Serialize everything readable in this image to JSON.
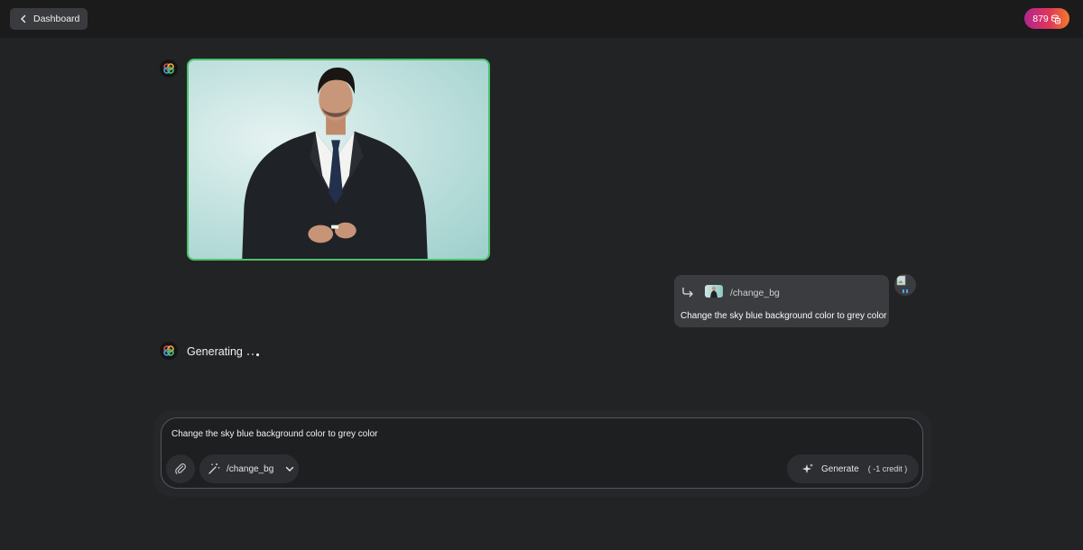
{
  "header": {
    "back_label": "Dashboard",
    "credits": "879"
  },
  "chat": {
    "generated_image_alt": "man in black suit against sky blue background",
    "user_message": {
      "command": "/change_bg",
      "text": "Change the sky blue background color to grey color"
    },
    "status": "Generating"
  },
  "composer": {
    "input_value": "Change the sky blue background color to grey color",
    "selected_command": "/change_bg",
    "generate_label": "Generate",
    "generate_cost": "( -1 credit )"
  },
  "colors": {
    "accent_border": "#4cc26a",
    "credits_gradient": [
      "#b0268f",
      "#e0365a",
      "#f47a2c"
    ]
  }
}
